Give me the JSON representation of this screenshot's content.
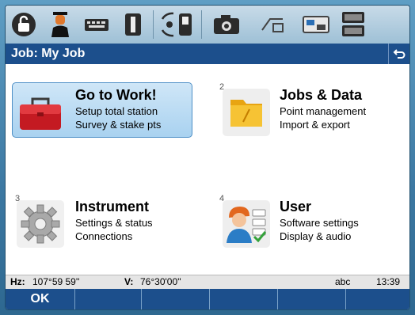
{
  "iconbar": {
    "icons": [
      "lock-icon",
      "user-profile-icon",
      "keyboard-icon",
      "instrument-icon",
      "radio-link-icon",
      "camera-icon",
      "measure-mode-icon",
      "target-prism-icon",
      "battery-icon"
    ]
  },
  "titlebar": {
    "title": "Job: My Job",
    "back_icon": "back-arrow-icon"
  },
  "tiles": [
    {
      "number": "",
      "title": "Go to Work!",
      "line1": "Setup total station",
      "line2": "Survey & stake pts",
      "icon": "toolbox-icon",
      "selected": true
    },
    {
      "number": "2",
      "title": "Jobs & Data",
      "line1": "Point management",
      "line2": "Import & export",
      "icon": "folder-icon",
      "selected": false
    },
    {
      "number": "3",
      "title": "Instrument",
      "line1": "Settings & status",
      "line2": "Connections",
      "icon": "gear-icon",
      "selected": false
    },
    {
      "number": "4",
      "title": "User",
      "line1": "Software settings",
      "line2": "Display & audio",
      "icon": "user-settings-icon",
      "selected": false
    }
  ],
  "statusline": {
    "hz_label": "Hz:",
    "hz_value": "107°59 59''",
    "v_label": "V:",
    "v_value": "76°30'00''",
    "input_mode": "abc",
    "time": "13:39"
  },
  "softkeys": [
    "OK",
    "",
    "",
    "",
    "",
    ""
  ],
  "colors": {
    "accent": "#1c4f8c",
    "selection": "#a9d2f0",
    "toolbox": "#d8242e",
    "folder": "#f2b81e"
  }
}
